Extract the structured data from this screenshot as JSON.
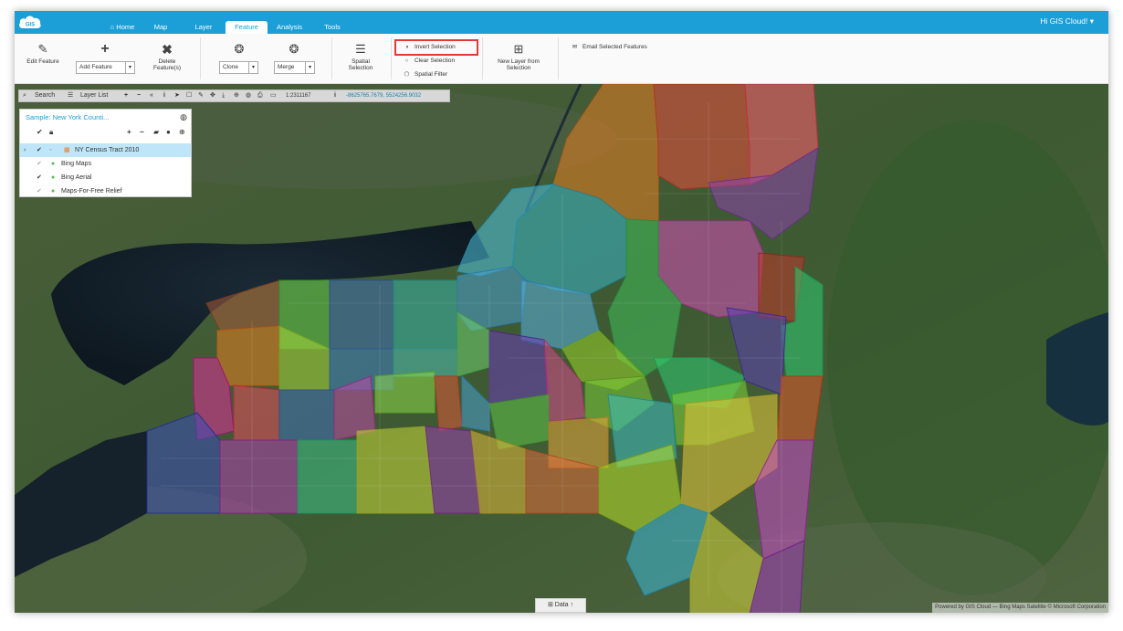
{
  "nav": {
    "logo_text": "GIS",
    "tabs": [
      {
        "label": "Home",
        "icon": "home-icon"
      },
      {
        "label": "Map"
      },
      {
        "label": "Layer"
      },
      {
        "label": "Feature",
        "active": true
      },
      {
        "label": "Analysis"
      },
      {
        "label": "Tools"
      }
    ],
    "greeting": "Hi GIS Cloud! ▾"
  },
  "toolbar": {
    "edit_feature": "Edit Feature",
    "add_feature": "Add Feature",
    "delete_feature_line1": "Delete",
    "delete_feature_line2": "Feature(s)",
    "clone": "Clone",
    "merge": "Merge",
    "spatial_selection_line1": "Spatial",
    "spatial_selection_line2": "Selection",
    "invert_selection": "Invert Selection",
    "clear_selection": "Clear Selection",
    "spatial_filter": "Spatial Filter",
    "new_layer_line1": "New Layer from",
    "new_layer_line2": "Selection",
    "email_selected": "Email Selected Features"
  },
  "map_controls": {
    "search": "Search",
    "layer_list": "Layer List",
    "scale": "1:2311167",
    "coordinates": "-8625765.7679, 5524256.9032"
  },
  "layer_panel": {
    "title": "Sample: New York Counti...",
    "layers": [
      {
        "name": "NY Census Tract 2010",
        "checked": true,
        "selected": true
      },
      {
        "name": "Bing Maps",
        "checked": false
      },
      {
        "name": "Bing Aerial",
        "checked": true
      },
      {
        "name": "Maps-For-Free Relief",
        "checked": false
      }
    ]
  },
  "data_tab": "Data",
  "attribution": "Powered by GIS Cloud — Bing Maps Satellite © Microsoft Corporation",
  "colors": {
    "brand": "#1c9ed6",
    "highlight_border": "#e53935"
  }
}
